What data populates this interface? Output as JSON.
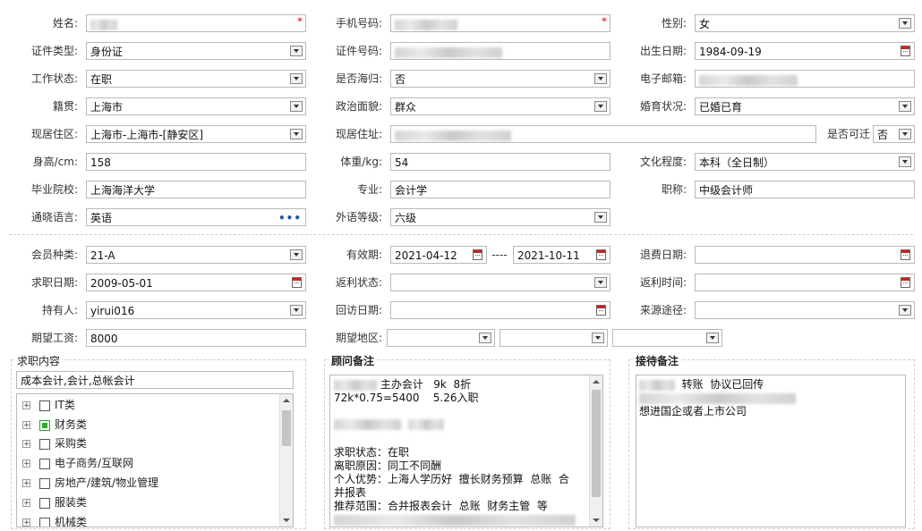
{
  "personal": {
    "name": {
      "label": "姓名:",
      "value": ""
    },
    "phone": {
      "label": "手机号码:",
      "value": ""
    },
    "gender": {
      "label": "性别:",
      "value": "女"
    },
    "id_type": {
      "label": "证件类型:",
      "value": "身份证"
    },
    "id_number": {
      "label": "证件号码:",
      "value": ""
    },
    "birth_date": {
      "label": "出生日期:",
      "value": "1984-09-19"
    },
    "work_status": {
      "label": "工作状态:",
      "value": "在职"
    },
    "overseas": {
      "label": "是否海归:",
      "value": "否"
    },
    "email": {
      "label": "电子邮箱:",
      "value": ""
    },
    "native_place": {
      "label": "籍贯:",
      "value": "上海市"
    },
    "political": {
      "label": "政治面貌:",
      "value": "群众"
    },
    "marital": {
      "label": "婚育状况:",
      "value": "已婚已育"
    },
    "residence_area": {
      "label": "现居住区:",
      "value": "上海市-上海市-[静安区]"
    },
    "residence_address": {
      "label": "现居住址:",
      "value": ""
    },
    "relocatable": {
      "label": "是否可迁",
      "value": "否"
    },
    "height": {
      "label": "身高/cm:",
      "value": "158"
    },
    "weight": {
      "label": "体重/kg:",
      "value": "54"
    },
    "education": {
      "label": "文化程度:",
      "value": "本科（全日制）"
    },
    "school": {
      "label": "毕业院校:",
      "value": "上海海洋大学"
    },
    "major": {
      "label": "专业:",
      "value": "会计学"
    },
    "title": {
      "label": "职称:",
      "value": "中级会计师"
    },
    "language": {
      "label": "通晓语言:",
      "value": "英语"
    },
    "lang_level": {
      "label": "外语等级:",
      "value": "六级"
    }
  },
  "membership": {
    "member_type": {
      "label": "会员种类:",
      "value": "21-A"
    },
    "valid_period": {
      "label": "有效期:",
      "from": "2021-04-12",
      "sep": "----",
      "to": "2021-10-11"
    },
    "refund_date": {
      "label": "退费日期:",
      "value": ""
    },
    "job_date": {
      "label": "求职日期:",
      "value": "2009-05-01"
    },
    "rebate_status": {
      "label": "返利状态:",
      "value": ""
    },
    "rebate_time": {
      "label": "返利时间:",
      "value": ""
    },
    "holder": {
      "label": "持有人:",
      "value": "yirui016"
    },
    "visit_date": {
      "label": "回访日期:",
      "value": ""
    },
    "source": {
      "label": "来源途径:",
      "value": ""
    },
    "expected_salary": {
      "label": "期望工资:",
      "value": "8000"
    },
    "expected_area": {
      "label": "期望地区:",
      "values": [
        "",
        "",
        ""
      ]
    }
  },
  "job_content": {
    "title": "求职内容",
    "summary": "成本会计,会计,总帐会计",
    "categories": [
      {
        "label": "IT类",
        "checked": false
      },
      {
        "label": "财务类",
        "checked": true
      },
      {
        "label": "采购类",
        "checked": false
      },
      {
        "label": "电子商务/互联网",
        "checked": false
      },
      {
        "label": "房地产/建筑/物业管理",
        "checked": false
      },
      {
        "label": "服装类",
        "checked": false
      },
      {
        "label": "机械类",
        "checked": false
      }
    ]
  },
  "advisor_notes": {
    "title": "顾问备注",
    "line1": "主办会计   9k  8折",
    "line2": "72k*0.75=5400    5.26入职",
    "line4": "求职状态：在职",
    "line5": "离职原因：同工不同酬",
    "line6": "个人优势：上海人学历好  擅长财务预算  总账  合",
    "line7": "并报表",
    "line8": "推荐范围：合并报表会计  总账  财务主管  等"
  },
  "reception_notes": {
    "title": "接待备注",
    "line1": "转账  协议已回传",
    "line3": "想进国企或者上市公司"
  }
}
